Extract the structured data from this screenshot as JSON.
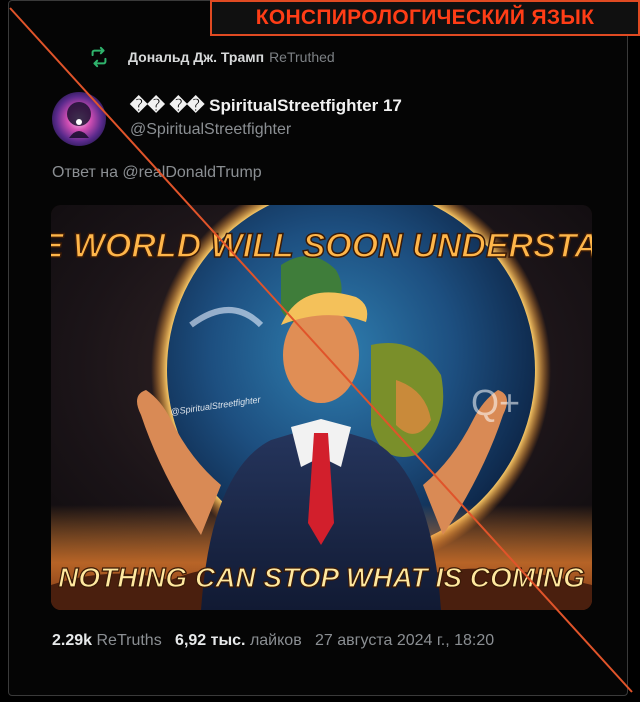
{
  "banner": {
    "label": "КОНСПИРОЛОГИЧЕСКИЙ ЯЗЫК"
  },
  "retruth": {
    "icon": "retruth-icon",
    "name": "Дональд Дж. Трамп",
    "tag": "ReTruthed"
  },
  "author": {
    "display_name": "�� �� SpiritualStreetfighter 17",
    "handle": "@SpiritualStreetfighter"
  },
  "reply": {
    "text": "Ответ на @realDonaldTrump"
  },
  "image": {
    "top_text": "THE WORLD WILL SOON UNDERSTAND",
    "bottom_text": "NOTHING CAN STOP WHAT IS COMING",
    "watermark": "@SpiritualStreetfighter",
    "q_mark": "Q+"
  },
  "stats": {
    "retruths_count": "2.29k",
    "retruths_label": "ReTruths",
    "likes_count": "6,92 тыс.",
    "likes_label": "лайков",
    "date": "27 августа 2024 г., 18:20"
  },
  "colors": {
    "banner_text": "#ff3d16",
    "retruth_icon": "#2fb36c",
    "cross_line": "#e0542a"
  }
}
